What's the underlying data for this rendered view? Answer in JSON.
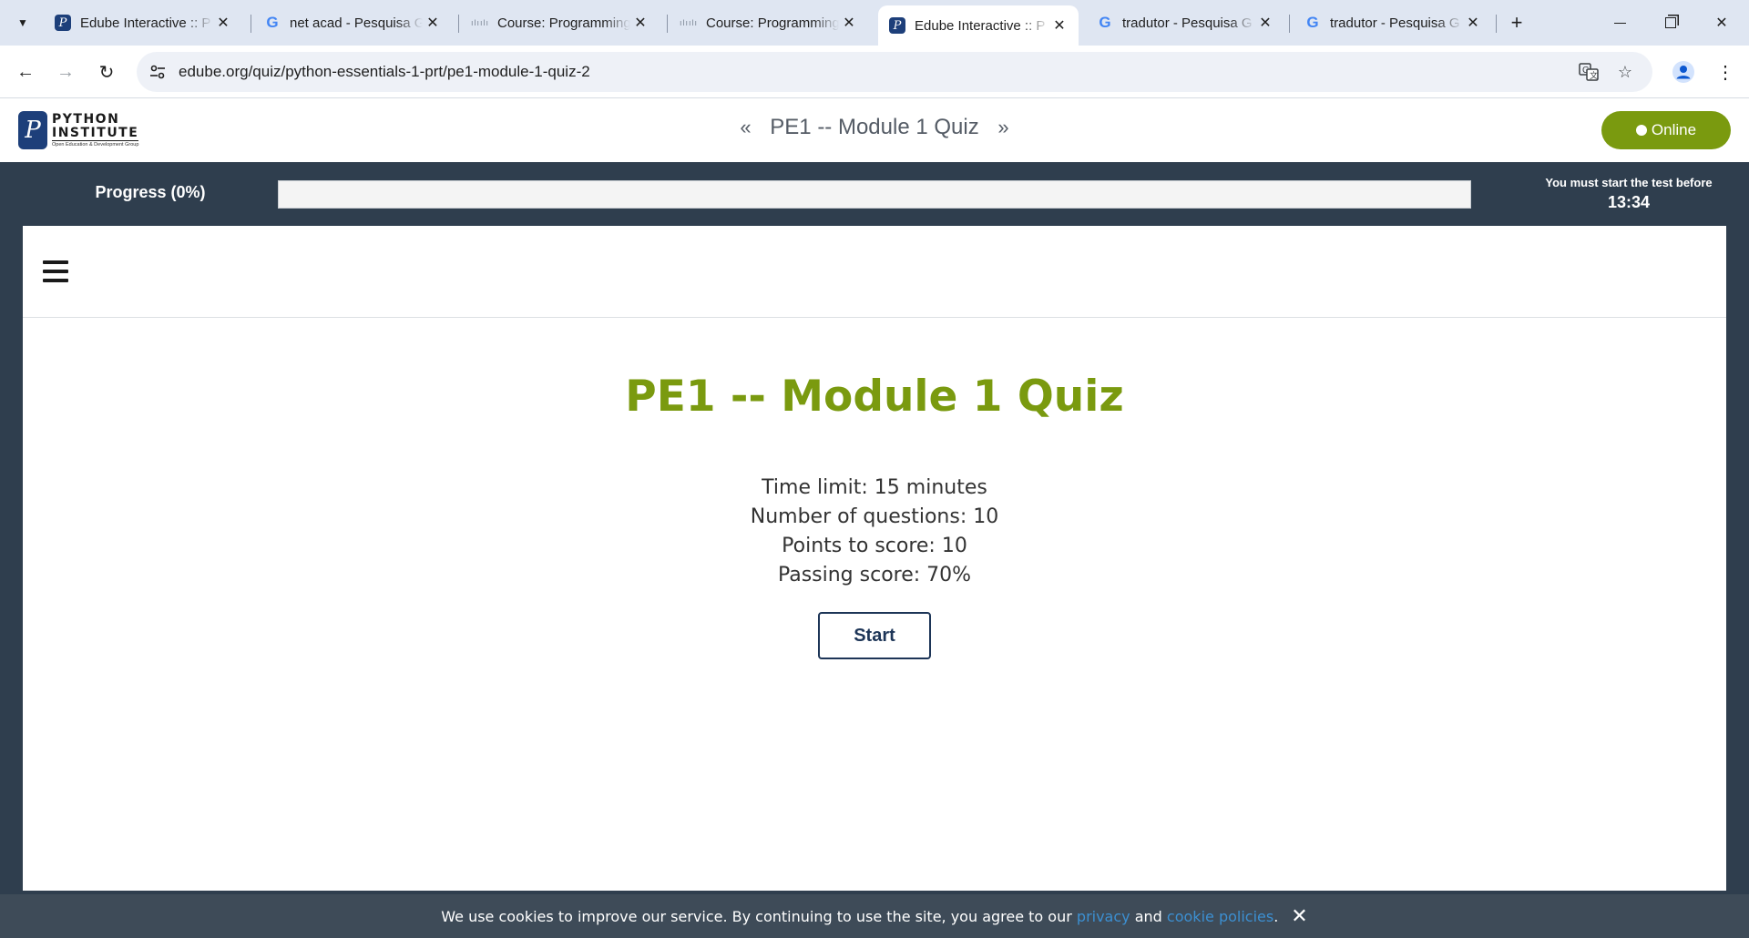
{
  "browser": {
    "tabs": [
      {
        "title": "Edube Interactive :: P",
        "favicon": "python-institute-icon",
        "active": false
      },
      {
        "title": "net acad - Pesquisa G",
        "favicon": "google-icon",
        "active": false
      },
      {
        "title": "Course: Programming",
        "favicon": "cisco-icon",
        "active": false
      },
      {
        "title": "Course: Programming",
        "favicon": "cisco-icon",
        "active": false
      },
      {
        "title": "Edube Interactive :: P",
        "favicon": "python-institute-icon",
        "active": true
      },
      {
        "title": "tradutor - Pesquisa G",
        "favicon": "google-icon",
        "active": false
      },
      {
        "title": "tradutor - Pesquisa G",
        "favicon": "google-icon",
        "active": false
      }
    ],
    "url": "edube.org/quiz/python-essentials-1-prt/pe1-module-1-quiz-2"
  },
  "header": {
    "logo": {
      "line1": "PYTHON",
      "line2": "INSTITUTE",
      "line3": "Open Education & Development Group"
    },
    "quiz_nav_title": "PE1 -- Module 1 Quiz",
    "online_label": "Online"
  },
  "progress": {
    "label": "Progress (0%)",
    "value": 0,
    "deadline_label": "You must start the test before",
    "deadline_time": "13:34"
  },
  "quiz": {
    "title": "PE1 -- Module 1 Quiz",
    "time_limit": "Time limit: 15 minutes",
    "questions": "Number of questions: 10",
    "points": "Points to score: 10",
    "passing": "Passing score: 70%",
    "start_label": "Start"
  },
  "cookie": {
    "text_before": "We use cookies to improve our service. By continuing to use the site, you agree to our",
    "privacy_link": "privacy",
    "and": "and",
    "cookie_link": "cookie policies",
    "end": "."
  },
  "colors": {
    "brand_green": "#7a9a0f",
    "dark_bg": "#2f3e4e",
    "navy": "#1d3557",
    "link_blue": "#3c8fd1"
  }
}
